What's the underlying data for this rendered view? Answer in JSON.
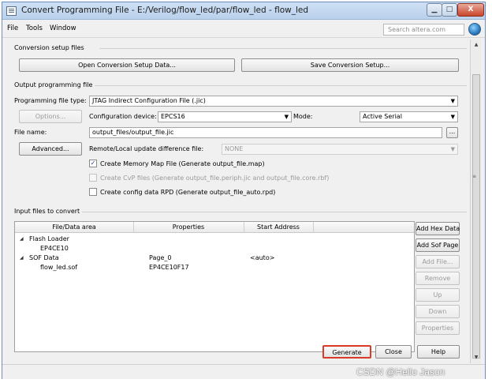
{
  "window": {
    "title": "Convert Programming File - E:/Verilog/flow_led/par/flow_led - flow_led",
    "min_label": "▁",
    "max_label": "□",
    "close_label": "X"
  },
  "menu": {
    "file": "File",
    "tools": "Tools",
    "window": "Window",
    "search_placeholder": "Search altera.com"
  },
  "conversion_setup": {
    "title": "Conversion setup files",
    "open_button": "Open Conversion Setup Data...",
    "save_button": "Save Conversion Setup..."
  },
  "output": {
    "title": "Output programming file",
    "type_label": "Programming file type:",
    "type_value": "JTAG Indirect Configuration File (.jic)",
    "options_button": "Options...",
    "device_label": "Configuration device:",
    "device_value": "EPCS16",
    "mode_label": "Mode:",
    "mode_value": "Active Serial",
    "filename_label": "File name:",
    "filename_value": "output_files/output_file.jic",
    "browse_button": "...",
    "advanced_button": "Advanced...",
    "remote_label": "Remote/Local update difference file:",
    "remote_value": "NONE",
    "chk_memory_map": "Create Memory Map File (Generate output_file.map)",
    "chk_memory_map_checked": true,
    "chk_cvp": "Create CvP files (Generate output_file.periph.jic and output_file.core.rbf)",
    "chk_cvp_checked": false,
    "chk_rpd": "Create config data RPD (Generate output_file_auto.rpd)",
    "chk_rpd_checked": false
  },
  "input_files": {
    "title": "Input files to convert",
    "columns": [
      "File/Data area",
      "Properties",
      "Start Address"
    ],
    "rows": [
      {
        "col1": "Flash Loader",
        "col2": "",
        "col3": "",
        "expander": "◢"
      },
      {
        "col1": "EP4CE10",
        "col2": "",
        "col3": "",
        "expander": ""
      },
      {
        "col1": "SOF Data",
        "col2": "Page_0",
        "col3": "<auto>",
        "expander": "◢"
      },
      {
        "col1": "flow_led.sof",
        "col2": "EP4CE10F17",
        "col3": "",
        "expander": ""
      }
    ],
    "side_buttons": {
      "add_hex": "Add Hex Data",
      "add_sof": "Add Sof Page",
      "add_file": "Add File...",
      "remove": "Remove",
      "up": "Up",
      "down": "Down",
      "properties": "Properties"
    }
  },
  "footer": {
    "generate": "Generate",
    "close": "Close",
    "help": "Help"
  },
  "watermark": "CSDN @Hello Jason"
}
